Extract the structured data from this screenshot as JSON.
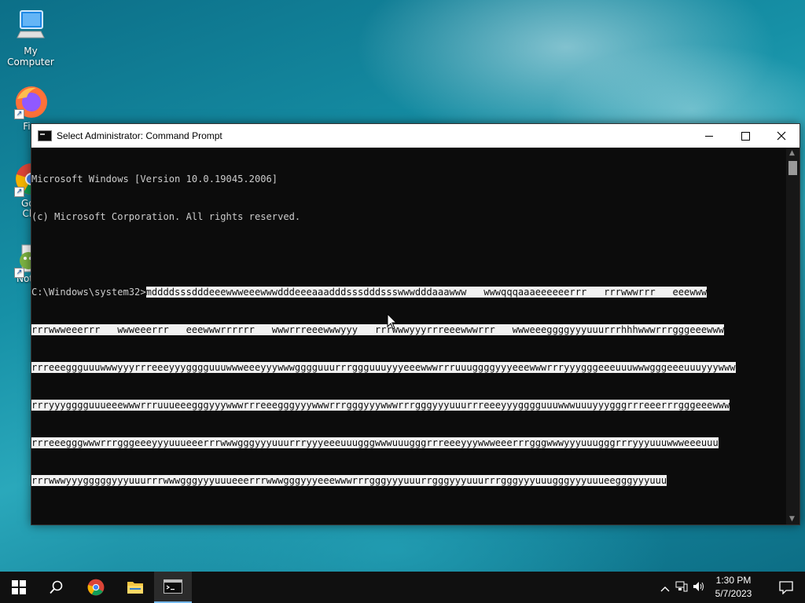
{
  "desktop": {
    "icons": [
      {
        "label": "My Computer"
      },
      {
        "label": "Fire"
      },
      {
        "label": "Goo"
      },
      {
        "label": "Chr"
      },
      {
        "label": "Notep"
      }
    ]
  },
  "window": {
    "title": "Select Administrator: Command Prompt",
    "console": {
      "line1": "Microsoft Windows [Version 10.0.19045.2006]",
      "line2": "(c) Microsoft Corporation. All rights reserved.",
      "prompt": "C:\\Windows\\system32>",
      "sel1": "mddddsssdddeeewwweeewwwdddeeeaaadddsssdddssswwwdddaaawww   wwwqqqaaaeeeeeerrr   rrrwwwrrr   eeewww",
      "sel2": "rrrwwweeerrr   wwweeerrr   eeewwwrrrrrr   wwwrrreeewwwyyy   rrrwwwyyyrrreeewwwrrr   wwweeeggggyyyuuurrrhhhwwwrrrgggeeewww",
      "sel3": "rrreeeggguuuwwwyyyrrreeeyyygggguuuwwweeeyyywwwgggguuurrrggguuuyyyeeewwwrrruuuggggyyyeeewwwrrryyygggeeeuuuwwwgggeeeuuuyyywww",
      "sel4": "rrryyygggguuueeewwwrrruuueeegggyyywwwrrreeegggyyywwwrrrgggyyywwwrrrgggyyyuuurrreeeyyygggguuuwwwuuuyyygggrrreeerrrgggeeewww",
      "sel5": "rrreeegggwwwrrrgggeeeyyyuuueeerrrwwwgggyyyuuurrryyyeeeuuugggwwwuuugggrrreeeyyywwweeerrrgggwwwyyyuuugggrrryyyuuuwwweeeuuu",
      "sel6": "rrrwwwyyygggggyyyuuurrrwwwgggyyyuuueeerrrwwwgggyyyeeewwwrrrgggyyyuuurrgggyyyuuurrrgggyyyuuugggyyyuuueegggyyyuuu"
    }
  },
  "taskbar": {
    "time": "1:30 PM",
    "date": "5/7/2023"
  }
}
